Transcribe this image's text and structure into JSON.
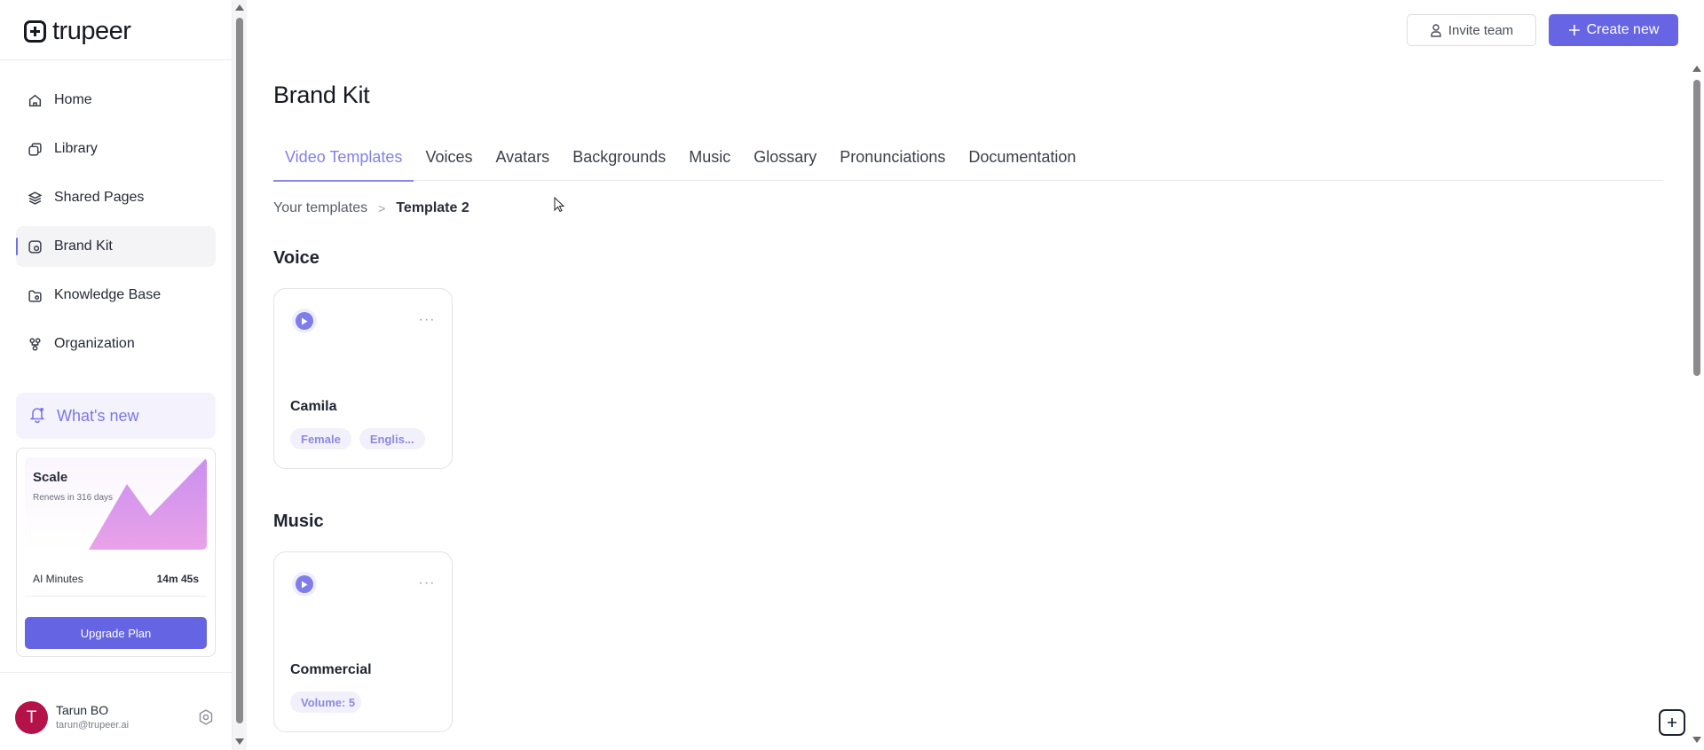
{
  "app": {
    "logo_text": "trupeer"
  },
  "sidebar": {
    "items": [
      {
        "label": "Home",
        "icon": "home-icon"
      },
      {
        "label": "Library",
        "icon": "library-icon"
      },
      {
        "label": "Shared Pages",
        "icon": "layers-icon"
      },
      {
        "label": "Brand Kit",
        "icon": "brand-kit-icon",
        "active": true
      },
      {
        "label": "Knowledge Base",
        "icon": "folder-icon"
      },
      {
        "label": "Organization",
        "icon": "organization-icon"
      }
    ],
    "whats_new": "What's new",
    "plan": {
      "name": "Scale",
      "renews": "Renews in 316 days",
      "minutes_label": "AI Minutes",
      "minutes_value": "14m 45s",
      "upgrade_label": "Upgrade Plan"
    },
    "user": {
      "initial": "T",
      "name": "Tarun BO",
      "email": "tarun@trupeer.ai"
    }
  },
  "header": {
    "invite_label": "Invite team",
    "create_label": "Create new"
  },
  "page": {
    "title": "Brand Kit",
    "tabs": [
      {
        "label": "Video Templates",
        "active": true
      },
      {
        "label": "Voices"
      },
      {
        "label": "Avatars"
      },
      {
        "label": "Backgrounds"
      },
      {
        "label": "Music"
      },
      {
        "label": "Glossary"
      },
      {
        "label": "Pronunciations"
      },
      {
        "label": "Documentation"
      }
    ],
    "breadcrumb": {
      "parent": "Your templates",
      "separator": ">",
      "current": "Template 2"
    },
    "sections": [
      {
        "title": "Voice",
        "card": {
          "title": "Camila",
          "tags": [
            "Female",
            "Englis..."
          ]
        }
      },
      {
        "title": "Music",
        "card": {
          "title": "Commercial",
          "tags": [
            "Volume: 5"
          ]
        }
      }
    ]
  },
  "colors": {
    "accent": "#6765e4",
    "accent_soft": "#f1f0fb",
    "avatar": "#b5124a"
  }
}
